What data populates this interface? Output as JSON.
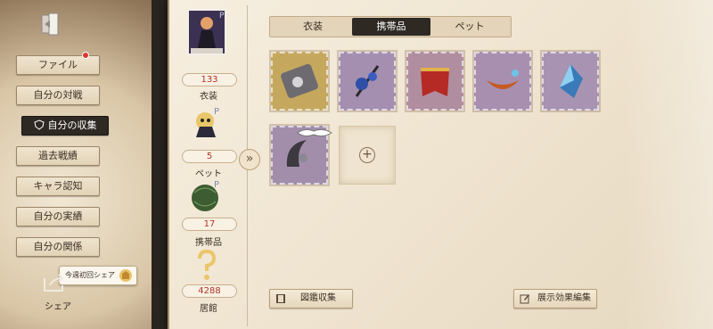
{
  "sidebar": {
    "items": [
      {
        "label": "ファイル",
        "active": false,
        "notification": true
      },
      {
        "label": "自分の対戦",
        "active": false
      },
      {
        "label": "自分の収集",
        "active": true
      },
      {
        "label": "過去戦績",
        "active": false
      },
      {
        "label": "キャラ認知",
        "active": false
      },
      {
        "label": "自分の実績",
        "active": false
      },
      {
        "label": "自分の関係",
        "active": false
      }
    ],
    "share_label": "シェア",
    "share_tooltip": "今週初回シェア"
  },
  "stats": [
    {
      "count": "133",
      "label": "衣装",
      "thumb": "costume-card-thumb"
    },
    {
      "count": "5",
      "label": "ペット",
      "thumb": "pet-thumb"
    },
    {
      "count": "17",
      "label": "携帯品",
      "thumb": "accessory-thumb"
    },
    {
      "count": "4288",
      "label": "居館",
      "thumb": "question-mark-icon"
    }
  ],
  "tabs": [
    {
      "label": "衣装",
      "active": false
    },
    {
      "label": "携帯品",
      "active": true
    },
    {
      "label": "ペット",
      "active": false
    }
  ],
  "items": [
    {
      "name": "gold-weapon-item",
      "frame_color": "#b99a4e"
    },
    {
      "name": "blue-flower-umbrella-item",
      "frame_color": "#9b88a6"
    },
    {
      "name": "red-banner-item",
      "frame_color": "#a88596"
    },
    {
      "name": "orange-boomerang-item",
      "frame_color": "#9e86a6"
    },
    {
      "name": "blue-crystal-item",
      "frame_color": "#a08aa8"
    },
    {
      "name": "dark-sickle-item",
      "frame_color": "#9a86a2"
    }
  ],
  "empty_slot_icon": "plus-icon",
  "footer": {
    "catalog_button": "図鑑収集",
    "edit_display_button": "展示効果編集"
  },
  "colors": {
    "accent_dark": "#2f2924",
    "count_red": "#b0342a",
    "notification": "#d83a2c"
  }
}
